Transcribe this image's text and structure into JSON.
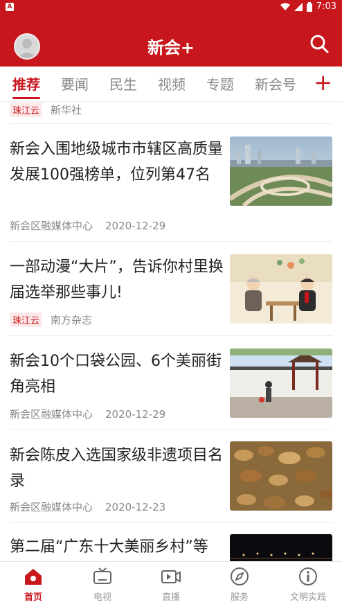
{
  "statusbar": {
    "time": "7:03"
  },
  "appbar": {
    "title": "新会+"
  },
  "tabs": [
    {
      "label": "推荐"
    },
    {
      "label": "要闻"
    },
    {
      "label": "民生"
    },
    {
      "label": "视频"
    },
    {
      "label": "专题"
    },
    {
      "label": "新会号"
    }
  ],
  "partial_item": {
    "tag": "珠江云",
    "source": "新华社"
  },
  "articles": [
    {
      "title": "新会入围地级城市市辖区高质量发展100强榜单，位列第47名",
      "source": "新会区融媒体中心",
      "date": "2020-12-29",
      "thumb": "city-aerial-image"
    },
    {
      "title": "一部动漫“大片”，告诉你村里换届选举那些事儿!",
      "tag": "珠江云",
      "source": "南方杂志",
      "thumb": "cartoon-image"
    },
    {
      "title": "新会10个口袋公园、6个美丽街角亮相",
      "source": "新会区融媒体中心",
      "date": "2020-12-29",
      "thumb": "park-image"
    },
    {
      "title": "新会陈皮入选国家级非遗项目名录",
      "source": "新会区融媒体中心",
      "date": "2020-12-23",
      "thumb": "dried-peel-image"
    },
    {
      "title": "第二届“广东十大美丽乡村”等",
      "thumb": "night-lights-image"
    }
  ],
  "bottomnav": [
    {
      "label": "首页",
      "icon": "home-icon"
    },
    {
      "label": "电视",
      "icon": "tv-icon"
    },
    {
      "label": "直播",
      "icon": "live-icon"
    },
    {
      "label": "服务",
      "icon": "compass-icon"
    },
    {
      "label": "文明实践",
      "icon": "info-icon"
    }
  ],
  "colors": {
    "brand": "#c8161d"
  }
}
